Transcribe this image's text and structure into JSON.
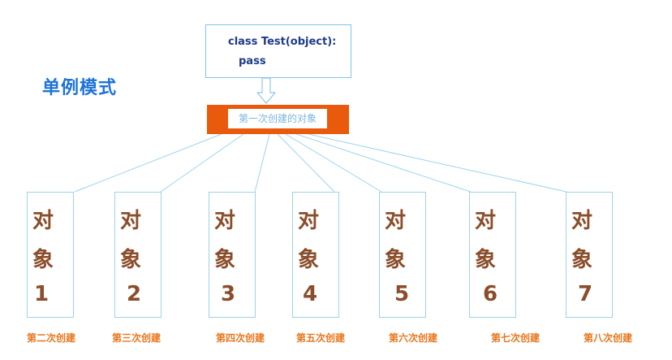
{
  "diagram": {
    "title": "单例模式",
    "code": {
      "line1": "class Test(object):",
      "line2": "pass"
    },
    "first_creation": "第一次创建的对象",
    "objects": [
      {
        "chars": [
          "对",
          "象",
          "1"
        ],
        "caption": "第二次创建"
      },
      {
        "chars": [
          "对",
          "象",
          "2"
        ],
        "caption": "第三次创建"
      },
      {
        "chars": [
          "对",
          "象",
          "3"
        ],
        "caption": "第四次创建"
      },
      {
        "chars": [
          "对",
          "象",
          "4"
        ],
        "caption": "第五次创建"
      },
      {
        "chars": [
          "对",
          "象",
          "5"
        ],
        "caption": "第六次创建"
      },
      {
        "chars": [
          "对",
          "象",
          "6"
        ],
        "caption": "第七次创建"
      },
      {
        "chars": [
          "对",
          "象",
          "7"
        ],
        "caption": "第八次创建"
      }
    ],
    "colors": {
      "title": "#1e73d8",
      "code_text": "#1f3a8a",
      "first_box": "#ea5a0c",
      "object_text": "#8b4d2a",
      "caption": "#e8761c",
      "connector": "#9cd4ea"
    }
  }
}
